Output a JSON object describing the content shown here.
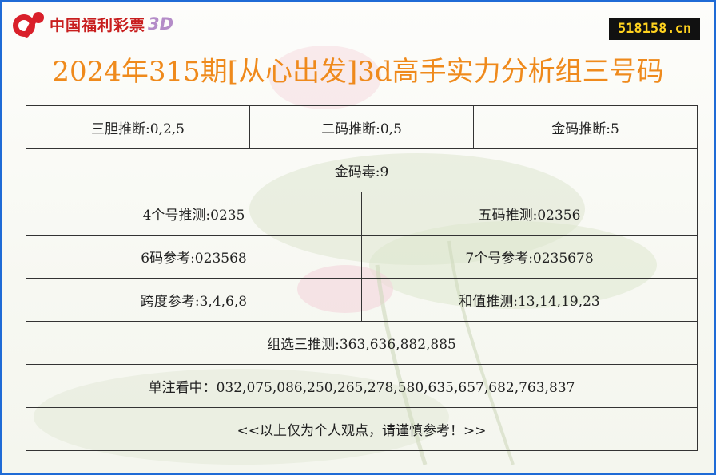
{
  "header": {
    "logo_text": "中国福利彩票",
    "logo_suffix": "3D",
    "site_badge": "518158.cn",
    "colors": {
      "brand_red": "#c81e1e",
      "title_orange": "#ef8a1c",
      "badge_yellow": "#ffd21f",
      "frame_blue": "#1f6bd6"
    }
  },
  "title": "2024年315期[从心出发]3d高手实力分析组三号码",
  "rows": [
    [
      "三胆推断:0,2,5",
      "二码推断:0,5",
      "金码推断:5"
    ],
    [
      "金码毒:9"
    ],
    [
      "4个号推测:0235",
      "五码推测:02356"
    ],
    [
      "6码参考:023568",
      "7个号参考:0235678"
    ],
    [
      "跨度参考:3,4,6,8",
      "和值推测:13,14,19,23"
    ],
    [
      "组选三推测:363,636,882,885"
    ],
    [
      "单注看中：032,075,086,250,265,278,580,635,657,682,763,837"
    ],
    [
      "<<以上仅为个人观点，请谨慎参考！>>"
    ]
  ]
}
